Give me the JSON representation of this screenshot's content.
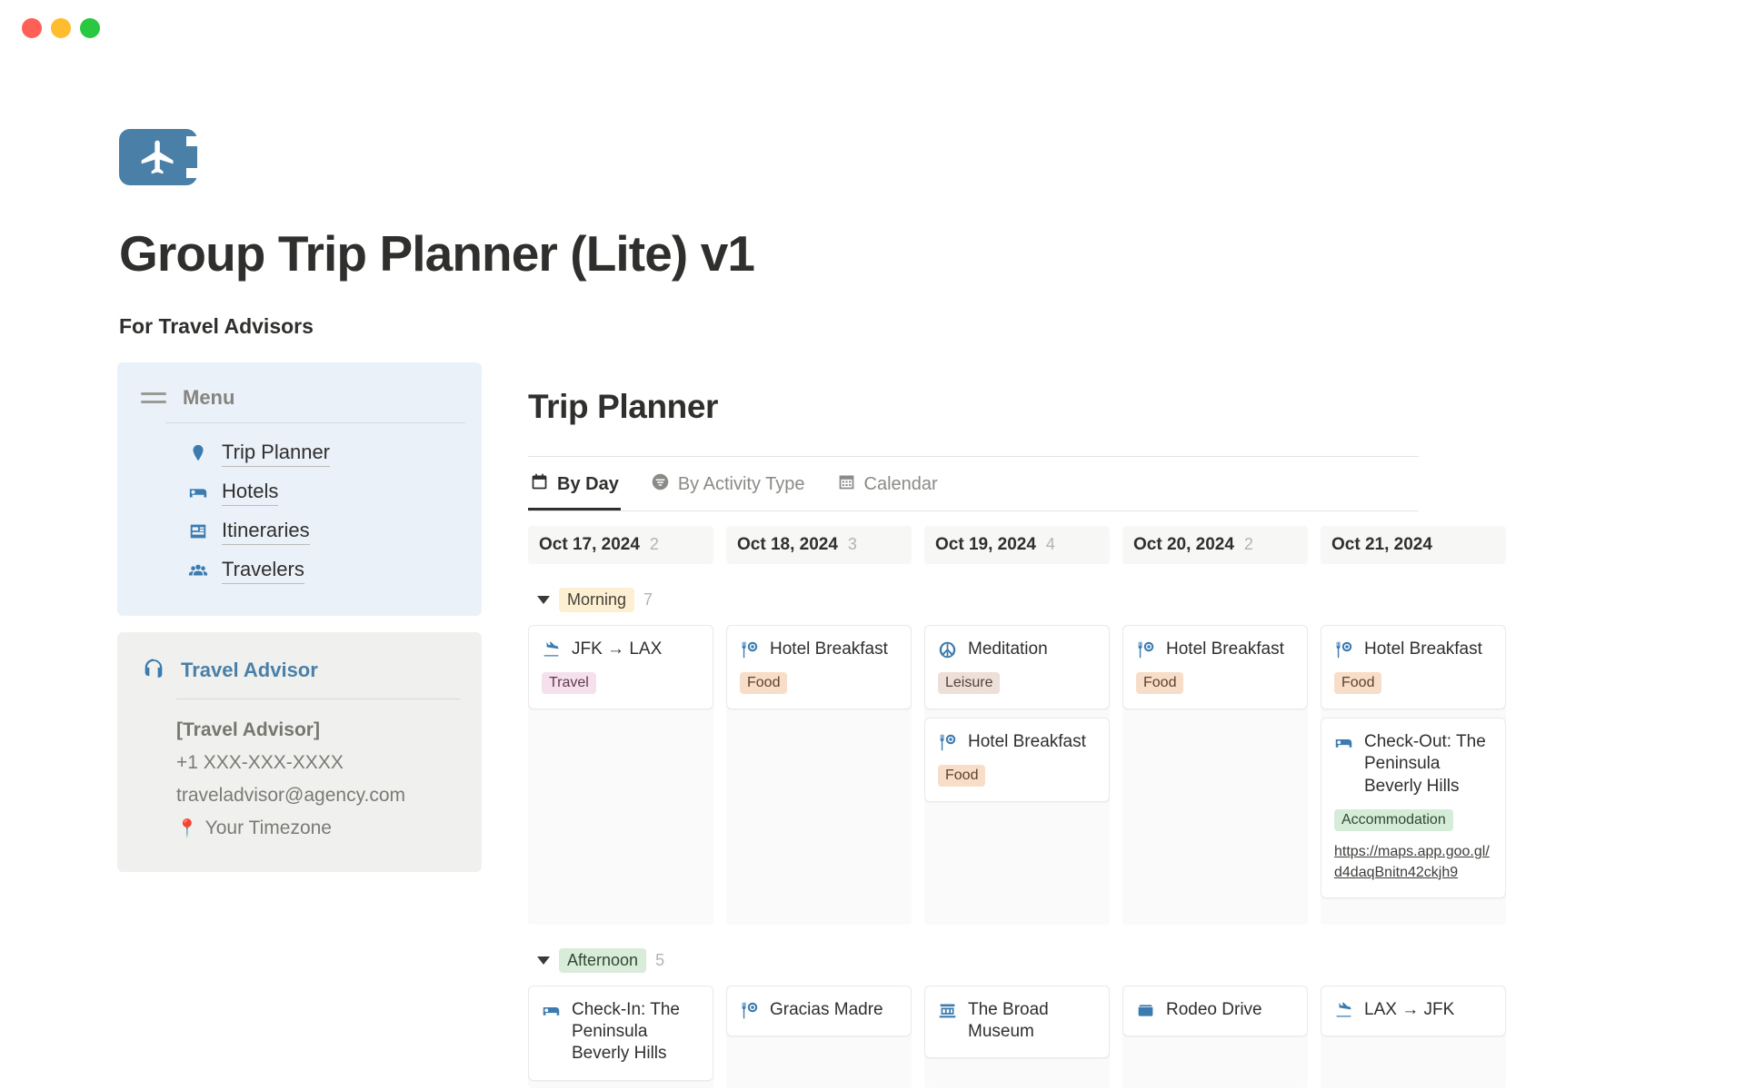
{
  "window": {
    "controls": [
      "close",
      "minimize",
      "maximize"
    ]
  },
  "header": {
    "logo_icon": "airplane-icon",
    "title": "Group Trip Planner (Lite) v1",
    "subtitle": "For Travel Advisors"
  },
  "sidebar": {
    "menu": {
      "icon": "hamburger-icon",
      "label": "Menu",
      "items": [
        {
          "icon": "map-pin-icon",
          "label": "Trip Planner"
        },
        {
          "icon": "bed-icon",
          "label": "Hotels"
        },
        {
          "icon": "id-card-icon",
          "label": "Itineraries"
        },
        {
          "icon": "people-icon",
          "label": "Travelers"
        }
      ]
    },
    "advisor": {
      "icon": "headset-icon",
      "title": "Travel Advisor",
      "name": "[Travel Advisor]",
      "phone": "+1 XXX-XXX-XXXX",
      "email": "traveladvisor@agency.com",
      "timezone_icon": "round-pushpin-emoji",
      "timezone": "Your Timezone"
    }
  },
  "main": {
    "title": "Trip Planner",
    "tabs": [
      {
        "icon": "calendar-day-icon",
        "label": "By Day",
        "active": true
      },
      {
        "icon": "filter-icon",
        "label": "By Activity Type",
        "active": false
      },
      {
        "icon": "calendar-grid-icon",
        "label": "Calendar",
        "active": false
      }
    ],
    "days": [
      {
        "date": "Oct 17, 2024",
        "count": "2"
      },
      {
        "date": "Oct 18, 2024",
        "count": "3"
      },
      {
        "date": "Oct 19, 2024",
        "count": "4"
      },
      {
        "date": "Oct 20, 2024",
        "count": "2"
      },
      {
        "date": "Oct 21, 2024",
        "count": ""
      }
    ],
    "groups": [
      {
        "name": "Morning",
        "badge_style": "morning",
        "count": "7",
        "lanes": [
          [
            {
              "icon": "airplane-departure-icon",
              "title": "JFK → LAX",
              "tag": "Travel",
              "tag_style": "tag-travel"
            }
          ],
          [
            {
              "icon": "food-icon",
              "title": "Hotel Breakfast",
              "tag": "Food",
              "tag_style": "tag-food"
            }
          ],
          [
            {
              "icon": "peace-icon",
              "title": "Meditation",
              "tag": "Leisure",
              "tag_style": "tag-leisure"
            },
            {
              "icon": "food-icon",
              "title": "Hotel Breakfast",
              "tag": "Food",
              "tag_style": "tag-food"
            }
          ],
          [
            {
              "icon": "food-icon",
              "title": "Hotel Breakfast",
              "tag": "Food",
              "tag_style": "tag-food"
            }
          ],
          [
            {
              "icon": "food-icon",
              "title": "Hotel Breakfast",
              "tag": "Food",
              "tag_style": "tag-food"
            },
            {
              "icon": "bed-icon",
              "title": "Check-Out: The Peninsula Beverly Hills",
              "tag": "Accommodation",
              "tag_style": "tag-accommodation",
              "url": "https://maps.app.goo.gl/d4daqBnitn42ckjh9"
            }
          ]
        ]
      },
      {
        "name": "Afternoon",
        "badge_style": "afternoon",
        "count": "5",
        "lanes": [
          [
            {
              "icon": "bed-icon",
              "title": "Check-In: The Peninsula Beverly Hills"
            }
          ],
          [
            {
              "icon": "food-icon",
              "title": "Gracias Madre"
            }
          ],
          [
            {
              "icon": "museum-icon",
              "title": "The Broad Museum"
            }
          ],
          [
            {
              "icon": "shopping-icon",
              "title": "Rodeo Drive"
            }
          ],
          [
            {
              "icon": "airplane-departure-icon",
              "title": "LAX → JFK"
            }
          ]
        ]
      }
    ]
  }
}
